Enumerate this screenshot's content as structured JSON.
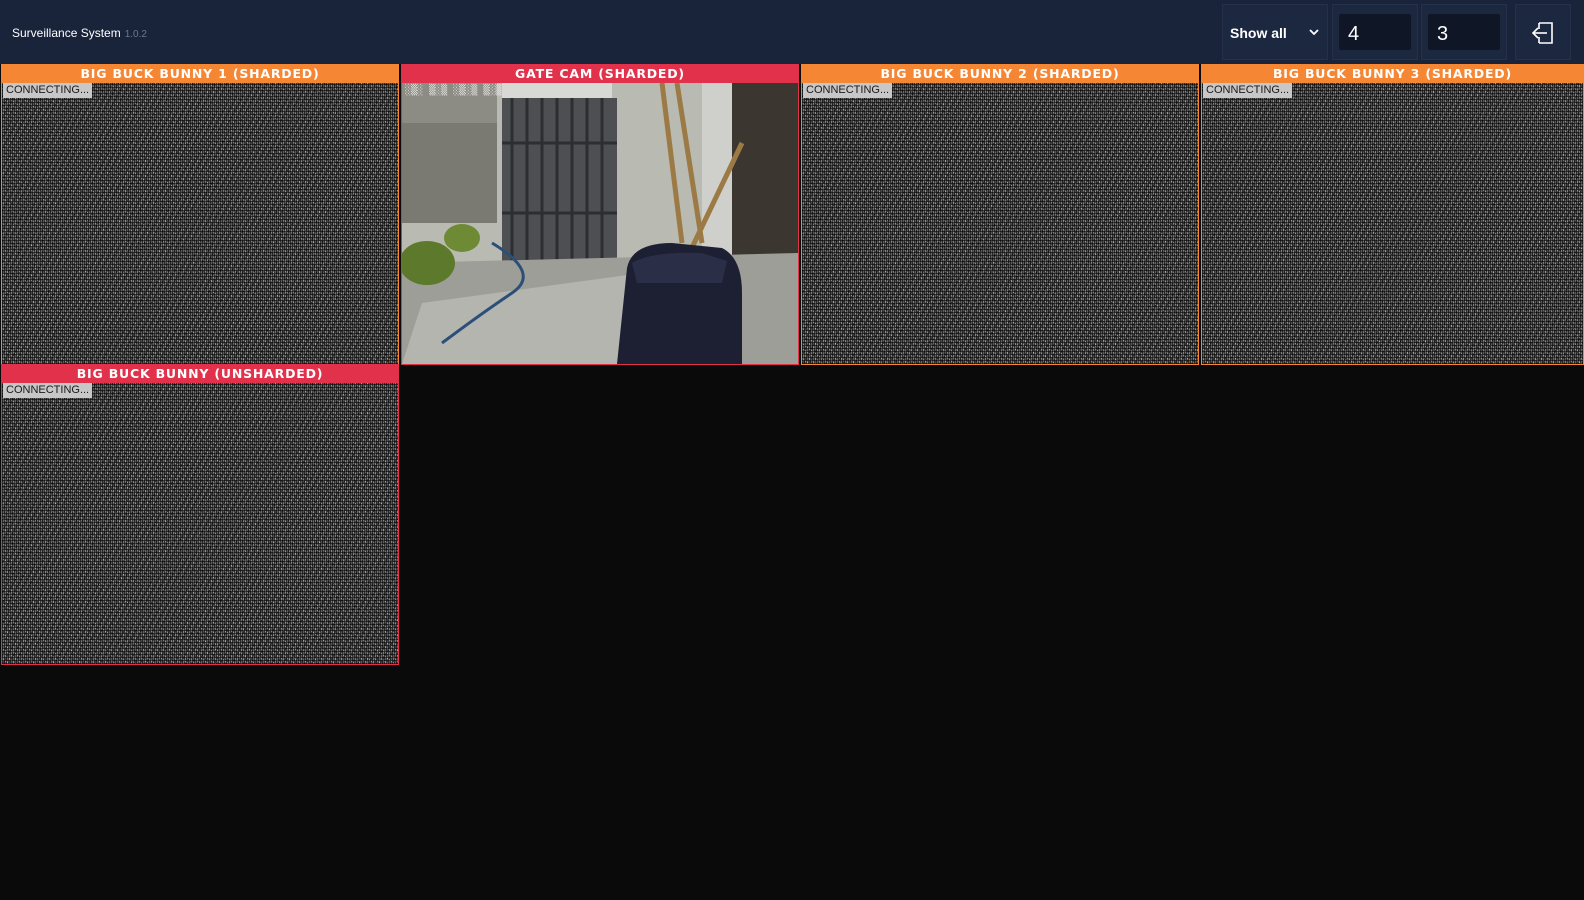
{
  "header": {
    "title": "Surveillance System",
    "version": "1.0.2",
    "filter": {
      "selected": "Show all"
    },
    "grid": {
      "columns": "4",
      "rows": "3"
    },
    "logout_icon": "logout-icon"
  },
  "colors": {
    "topbar": "#19233a",
    "sharded": "#f58634",
    "unsharded": "#e2314b",
    "live": "#e2314b"
  },
  "cameras": [
    {
      "title": "BIG BUCK BUNNY 1 (SHARDED)",
      "status": "CONNECTING..."
    },
    {
      "title": "GATE CAM (SHARDED)",
      "status": ""
    },
    {
      "title": "BIG BUCK BUNNY 2 (SHARDED)",
      "status": "CONNECTING..."
    },
    {
      "title": "BIG BUCK BUNNY 3 (SHARDED)",
      "status": "CONNECTING..."
    },
    {
      "title": "BIG BUCK BUNNY (UNSHARDED)",
      "status": "CONNECTING..."
    }
  ]
}
